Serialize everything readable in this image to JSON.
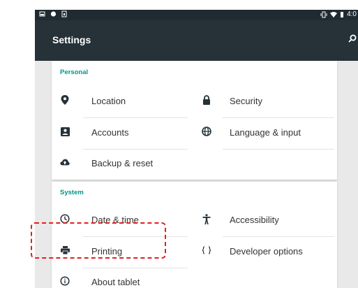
{
  "status_bar": {
    "left_icons": [
      "image-icon",
      "notification-dot-icon",
      "sim-icon"
    ],
    "right_icons": [
      "vibrate-icon",
      "wifi-icon",
      "battery-icon"
    ],
    "time": "4:0"
  },
  "app_bar": {
    "title": "Settings",
    "actions": [
      "search-icon"
    ]
  },
  "personal": {
    "header": "Personal",
    "items": [
      {
        "label": "Location",
        "icon": "location-pin-icon"
      },
      {
        "label": "Security",
        "icon": "lock-icon"
      },
      {
        "label": "Accounts",
        "icon": "account-icon"
      },
      {
        "label": "Language & input",
        "icon": "globe-icon"
      },
      {
        "label": "Backup & reset",
        "icon": "cloud-upload-icon"
      }
    ]
  },
  "system": {
    "header": "System",
    "items": [
      {
        "label": "Date & time",
        "icon": "clock-icon"
      },
      {
        "label": "Accessibility",
        "icon": "accessibility-icon"
      },
      {
        "label": "Printing",
        "icon": "print-icon"
      },
      {
        "label": "Developer options",
        "icon": "braces-icon"
      },
      {
        "label": "About tablet",
        "icon": "info-icon"
      }
    ]
  },
  "annotation": {
    "color": "#e0211f",
    "target": "Printing"
  },
  "colors": {
    "app_bar": "#263238",
    "status_bar": "#1f2a31",
    "accent": "#009688",
    "icon": "#263238",
    "background": "#e9e9e9"
  }
}
